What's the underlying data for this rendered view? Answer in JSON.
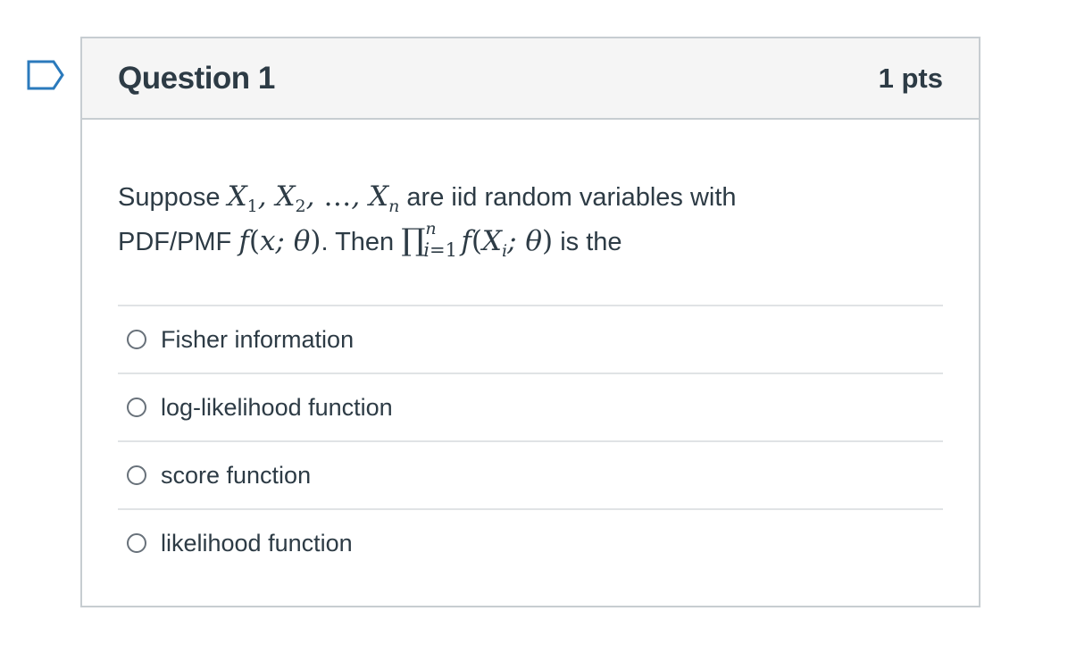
{
  "question": {
    "title": "Question 1",
    "points": "1 pts",
    "text_prefix": "Suppose",
    "text_middle": "are iid random variables with",
    "text_line2_prefix": "PDF/PMF",
    "text_then": ". Then",
    "text_suffix": "is the",
    "math": {
      "sample": "X₁, X₂, …, Xₙ",
      "density": "f(x; θ)",
      "product": "∏ᵢ₌₁ⁿ f(Xᵢ; θ)"
    }
  },
  "answers": [
    {
      "label": "Fisher information",
      "selected": false
    },
    {
      "label": "log-likelihood function",
      "selected": false
    },
    {
      "label": "score function",
      "selected": false
    },
    {
      "label": "likelihood function",
      "selected": false
    }
  ],
  "icons": {
    "flag": "bookmark-flag-icon"
  },
  "colors": {
    "flag_stroke": "#2b7abc",
    "border": "#c7cdd1",
    "header_bg": "#f5f5f5",
    "text": "#2d3b45"
  }
}
